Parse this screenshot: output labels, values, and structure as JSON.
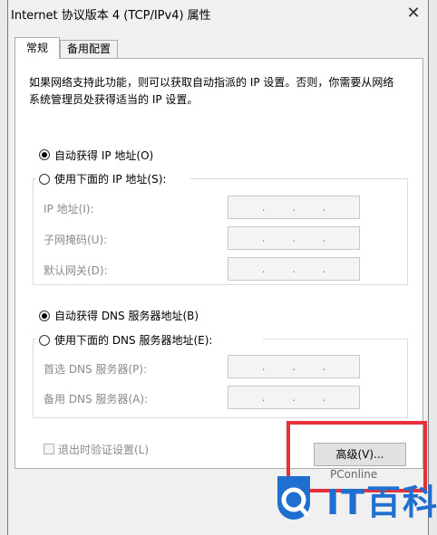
{
  "window": {
    "title": "Internet 协议版本 4 (TCP/IPv4) 属性",
    "close_glyph": "✕"
  },
  "tabs": [
    {
      "label": "常规",
      "selected": true
    },
    {
      "label": "备用配置",
      "selected": false
    }
  ],
  "description": "如果网络支持此功能，则可以获取自动指派的 IP 设置。否则，你需要从网络系统管理员处获得适当的 IP 设置。",
  "ip_section": {
    "auto_label": "自动获得 IP 地址(O)",
    "manual_label": "使用下面的 IP 地址(S):",
    "auto_selected": true,
    "fields": [
      {
        "label": "IP 地址(I):",
        "value": ". . ."
      },
      {
        "label": "子网掩码(U):",
        "value": ". . ."
      },
      {
        "label": "默认网关(D):",
        "value": ". . ."
      }
    ]
  },
  "dns_section": {
    "auto_label": "自动获得 DNS 服务器地址(B)",
    "manual_label": "使用下面的 DNS 服务器地址(E):",
    "auto_selected": true,
    "fields": [
      {
        "label": "首选 DNS 服务器(P):",
        "value": ". . ."
      },
      {
        "label": "备用 DNS 服务器(A):",
        "value": ". . ."
      }
    ]
  },
  "validate_checkbox": {
    "label": "退出时验证设置(L)",
    "checked": false
  },
  "advanced_button": {
    "label": "高级(V)..."
  },
  "watermark": {
    "brand": "PConline",
    "name": "IT百科"
  },
  "colors": {
    "highlight": "#e8303a",
    "watermark_blue": "#1f6fd1"
  },
  "icons": [
    "close-icon",
    "pconline-logo-icon"
  ]
}
